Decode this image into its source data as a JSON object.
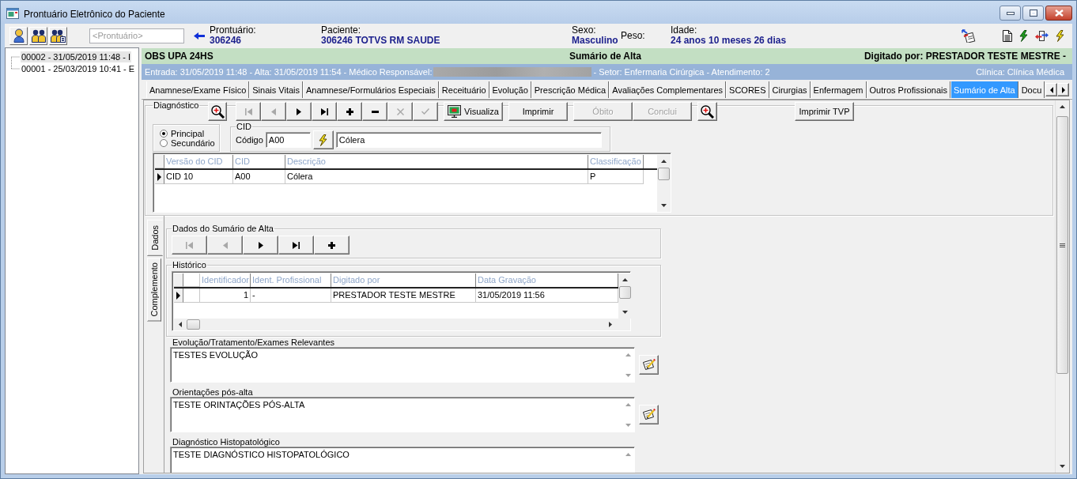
{
  "window": {
    "title": "Prontuário Eletrônico do Paciente"
  },
  "toolbar": {
    "search": {
      "placeholder": "<Prontuário>"
    },
    "patient": [
      {
        "label": "Prontuário:",
        "value": "306246"
      },
      {
        "label": "Paciente:",
        "value": "306246 TOTVS RM SAUDE"
      },
      {
        "label": "Sexo:",
        "value": "Masculino"
      },
      {
        "label": "Peso:"
      },
      {
        "label": "Idade:",
        "value": "24 anos 10 meses 26 dias"
      }
    ]
  },
  "tree": {
    "items": [
      {
        "label": "00002 - 31/05/2019 11:48 - I",
        "selected": true
      },
      {
        "label": "00001 - 25/03/2019 10:41 - E",
        "selected": false
      }
    ]
  },
  "header": {
    "unit": "OBS UPA 24HS",
    "screen": "Sumário de Alta",
    "typed_by": "Digitado por: PRESTADOR TESTE MESTRE -",
    "admission": "Entrada: 31/05/2019 11:48 - Alta: 31/05/2019 11:54 - Médico Responsável:",
    "sector": "- Setor: Enfermaria Cirúrgica - Atendimento: 2",
    "clinic": "Clínica: Clínica Médica"
  },
  "tabs": [
    {
      "label": "Anamnese/Exame Físico",
      "selected": false
    },
    {
      "label": "Sinais Vitais",
      "selected": false
    },
    {
      "label": "Anamnese/Formulários Especiais",
      "selected": false
    },
    {
      "label": "Receituário",
      "selected": false
    },
    {
      "label": "Evolução",
      "selected": false
    },
    {
      "label": "Prescrição Médica",
      "selected": false
    },
    {
      "label": "Avaliações Complementares",
      "selected": false
    },
    {
      "label": "SCORES",
      "selected": false
    },
    {
      "label": "Cirurgias",
      "selected": false
    },
    {
      "label": "Enfermagem",
      "selected": false
    },
    {
      "label": "Outros Profissionais",
      "selected": false
    },
    {
      "label": "Sumário de Alta",
      "selected": true
    },
    {
      "label": "Docu",
      "selected": false
    }
  ],
  "diagnosis": {
    "title": "Diagnóstico",
    "nav": [
      {
        "kind": "first",
        "disabled": true
      },
      {
        "kind": "prev",
        "disabled": true
      },
      {
        "kind": "next",
        "disabled": false
      },
      {
        "kind": "last",
        "disabled": false
      },
      {
        "kind": "add",
        "disabled": false
      },
      {
        "kind": "remove",
        "disabled": false
      },
      {
        "kind": "cancel",
        "disabled": true
      },
      {
        "kind": "confirm",
        "disabled": true
      }
    ],
    "actions": [
      {
        "label": "Visualiza",
        "kind": "view",
        "disabled": false
      },
      {
        "label": "Imprimir",
        "kind": "print",
        "disabled": false
      },
      {
        "label": "Óbito",
        "kind": "death",
        "disabled": true
      },
      {
        "label": "Conclui",
        "kind": "conclude",
        "disabled": true
      }
    ],
    "print_tvp": "Imprimir TVP",
    "type": [
      {
        "label": "Principal",
        "selected": true
      },
      {
        "label": "Secundário",
        "selected": false
      }
    ],
    "cid": {
      "title": "CID",
      "code_label": "Código",
      "code": "A00",
      "description": "Cólera"
    },
    "table": {
      "columns": [
        "Versão do CID",
        "CID",
        "Descrição",
        "Classificação"
      ],
      "rows": [
        {
          "selected": true,
          "cells": [
            "CID 10",
            "A00",
            "Cólera",
            "P"
          ]
        }
      ]
    }
  },
  "side_tabs": [
    {
      "label": "Dados",
      "selected": true
    },
    {
      "label": "Complemento",
      "selected": false
    }
  ],
  "summary": {
    "title": "Dados do Sumário de Alta",
    "nav": [
      {
        "kind": "first",
        "disabled": true
      },
      {
        "kind": "prev",
        "disabled": true
      },
      {
        "kind": "next",
        "disabled": false
      },
      {
        "kind": "last",
        "disabled": false
      },
      {
        "kind": "add",
        "disabled": false
      }
    ]
  },
  "history": {
    "title": "Histórico",
    "columns": [
      "Identificador",
      "Ident. Profissional",
      "Digitado por",
      "Data Gravação"
    ],
    "rows": [
      {
        "selected": true,
        "cells": [
          "1",
          "-",
          "PRESTADOR TESTE MESTRE",
          "31/05/2019 11:56"
        ]
      }
    ]
  },
  "notes": [
    {
      "label": "Evolução/Tratamento/Exames Relevantes",
      "value": "TESTES EVOLUÇÃO",
      "has_edit_button": true
    },
    {
      "label": "Orientações pós-alta",
      "value": "TESTE ORINTAÇÕES PÓS-ALTA",
      "has_edit_button": true
    },
    {
      "label": "Diagnóstico Histopatológico",
      "value": "TESTE DIAGNÓSTICO HISTOPATOLÓGICO",
      "has_edit_button": false
    }
  ]
}
